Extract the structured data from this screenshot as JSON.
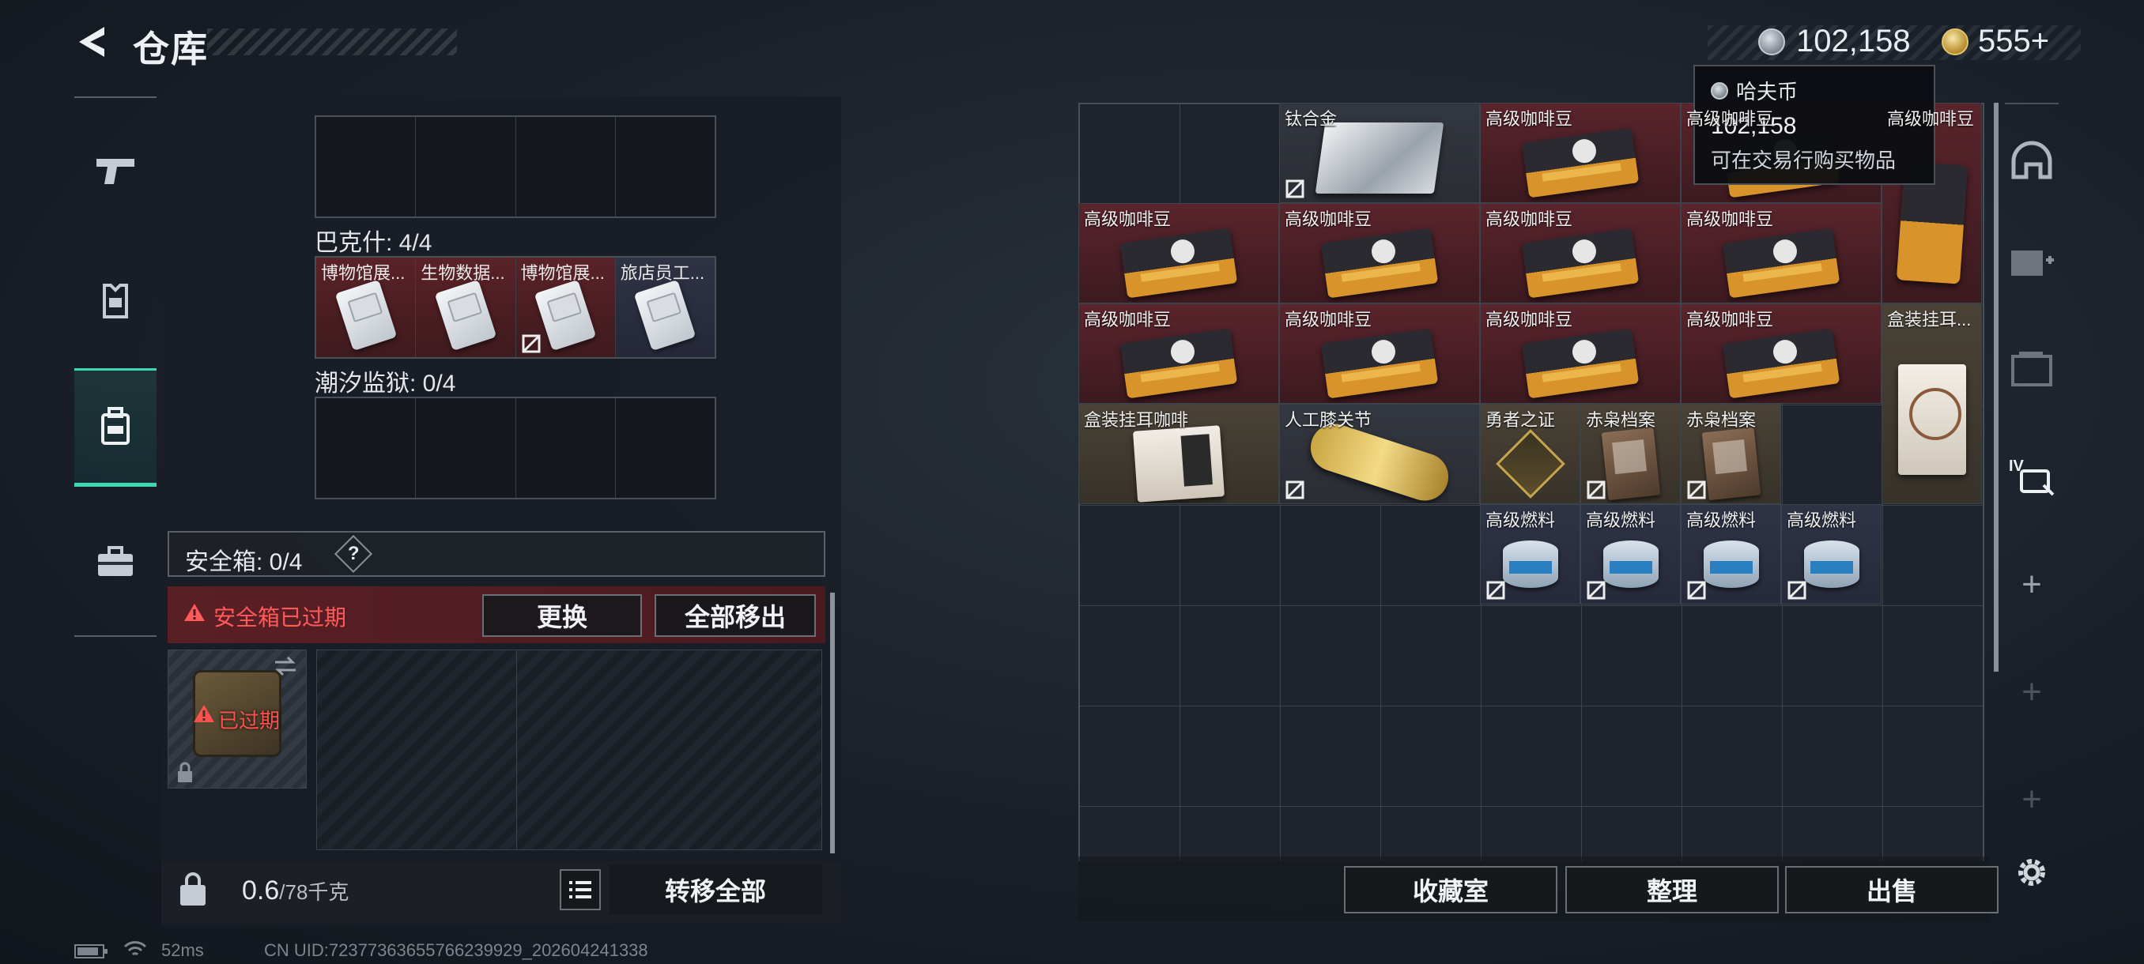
{
  "header": {
    "title": "仓库"
  },
  "currency": {
    "coin_amount": "102,158",
    "premium_amount": "555+"
  },
  "tooltip": {
    "title": "哈夫币",
    "value": "102,158",
    "description": "可在交易行购买物品"
  },
  "left_panel": {
    "section_top_partial": "",
    "section_bakesh": {
      "label": "巴克什: 4/4",
      "items": [
        "博物馆展...",
        "生物数据...",
        "博物馆展...",
        "旅店员工..."
      ]
    },
    "section_tide": {
      "label": "潮汐监狱: 0/4"
    },
    "safe_box": {
      "label": "安全箱: 0/4",
      "help": "?",
      "warning": "安全箱已过期",
      "replace_label": "更换",
      "move_all_out_label": "全部移出",
      "expired_label": "已过期"
    },
    "weight": {
      "current": "0.6",
      "max": "/78千克"
    },
    "transfer_all_label": "转移全部"
  },
  "right_grid": {
    "items": [
      {
        "name": "钛合金"
      },
      {
        "name": "高级咖啡豆"
      },
      {
        "name": "高级咖啡豆"
      },
      {
        "name": "高级咖啡豆"
      },
      {
        "name": "盒装挂耳..."
      },
      {
        "name": "盒装挂耳咖啡"
      },
      {
        "name": "人工膝关节"
      },
      {
        "name": "勇者之证"
      },
      {
        "name": "赤枭档案"
      },
      {
        "name": "高级燃料"
      }
    ]
  },
  "right_buttons": {
    "collection": "收藏室",
    "organize": "整理",
    "sell": "出售"
  },
  "status_bar": {
    "ping": "52ms",
    "uid": "CN UID:7237736365576623992​9_202604241338"
  },
  "colors": {
    "accent": "#3fd6b4",
    "warning": "#ff5a5a"
  },
  "icons": [
    "back-arrow-icon",
    "coin-icon",
    "gold-coin-icon",
    "gun-icon",
    "armor-icon",
    "backpack-icon",
    "briefcase-icon",
    "safe-lock-icon",
    "list-icon",
    "helmet-icon",
    "add-container-icon",
    "folder-icon",
    "level-iv-icon",
    "gear-icon",
    "battery-icon",
    "wifi-icon",
    "no-trade-icon",
    "warning-icon",
    "swap-icon",
    "lock-icon"
  ]
}
